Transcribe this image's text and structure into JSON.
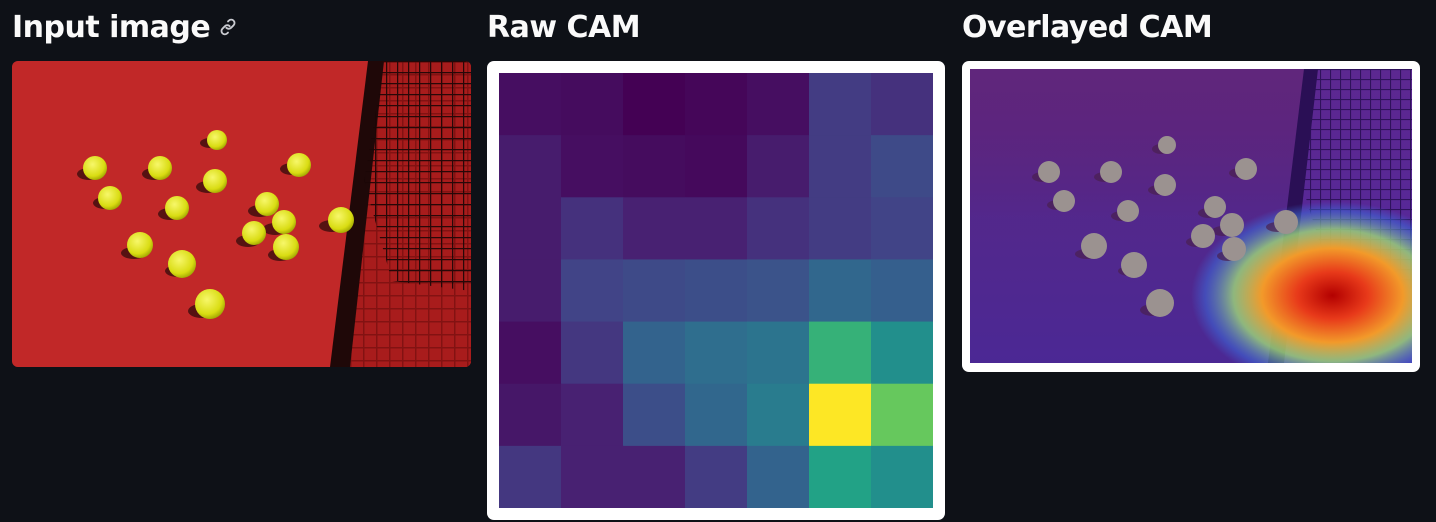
{
  "columns": {
    "input": {
      "title": "Input image",
      "link_icon": "link-icon"
    },
    "raw": {
      "title": "Raw CAM"
    },
    "overlay": {
      "title": "Overlayed CAM"
    }
  },
  "colors": {
    "background": "#0e1117",
    "text": "#fafafa",
    "court": "#c62a2a",
    "ball": "#e6e61a",
    "frame": "#ffffff"
  },
  "cam_grid": {
    "rows": 7,
    "cols": 7,
    "colormap": "viridis",
    "values": [
      [
        0.05,
        0.04,
        0.0,
        0.02,
        0.05,
        0.22,
        0.18
      ],
      [
        0.1,
        0.05,
        0.04,
        0.03,
        0.1,
        0.22,
        0.28
      ],
      [
        0.1,
        0.18,
        0.12,
        0.12,
        0.18,
        0.22,
        0.25
      ],
      [
        0.1,
        0.25,
        0.28,
        0.3,
        0.32,
        0.42,
        0.38
      ],
      [
        0.05,
        0.2,
        0.4,
        0.45,
        0.48,
        0.78,
        0.62
      ],
      [
        0.08,
        0.12,
        0.3,
        0.42,
        0.52,
        1.0,
        0.85
      ],
      [
        0.2,
        0.12,
        0.12,
        0.22,
        0.4,
        0.72,
        0.62
      ]
    ]
  }
}
